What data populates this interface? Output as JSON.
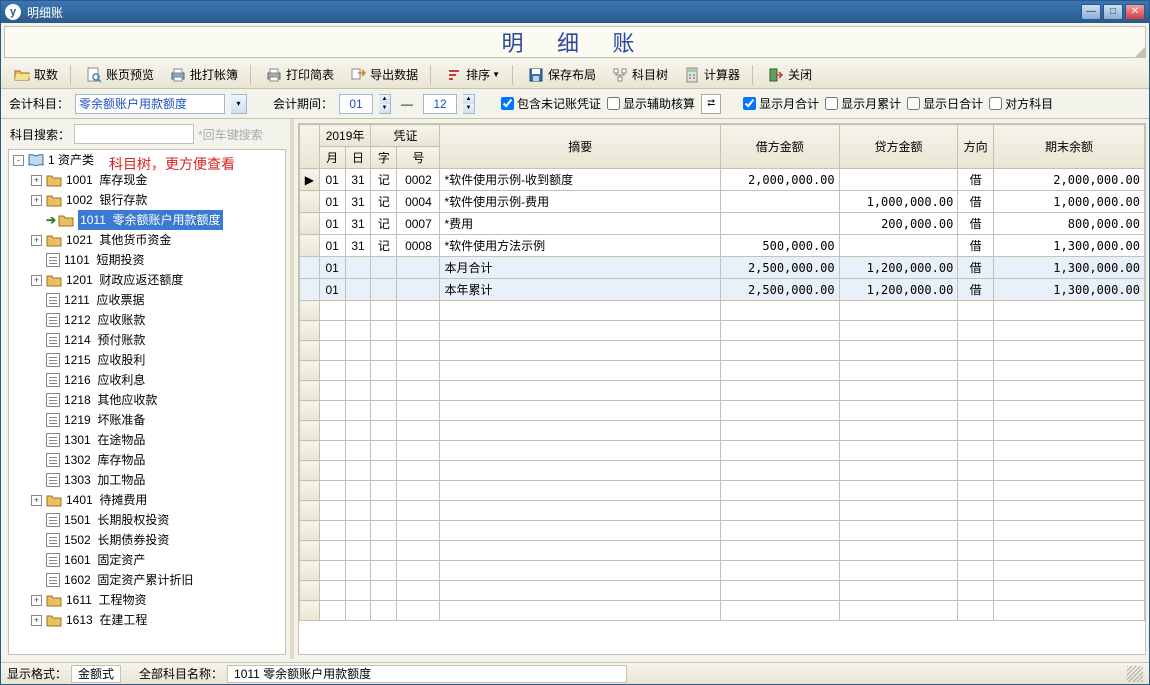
{
  "window": {
    "title": "明细账"
  },
  "header_title": "明 细 账",
  "toolbar": [
    {
      "id": "fetch",
      "label": "取数"
    },
    {
      "id": "preview",
      "label": "账页预览"
    },
    {
      "id": "batch",
      "label": "批打帐簿"
    },
    {
      "id": "print",
      "label": "打印简表"
    },
    {
      "id": "export",
      "label": "导出数据"
    },
    {
      "id": "sort",
      "label": "排序"
    },
    {
      "id": "savelay",
      "label": "保存布局"
    },
    {
      "id": "tree",
      "label": "科目树"
    },
    {
      "id": "calc",
      "label": "计算器"
    },
    {
      "id": "close",
      "label": "关闭"
    }
  ],
  "filter": {
    "subject_label": "会计科目：",
    "subject_value": "零余额账户用款额度",
    "period_label": "会计期间：",
    "period_from": "01",
    "period_to": "12",
    "dash": "—",
    "opts": {
      "include_unposted": {
        "label": "包含未记账凭证",
        "checked": true
      },
      "show_aux": {
        "label": "显示辅助核算",
        "checked": false
      },
      "show_month": {
        "label": "显示月合计",
        "checked": true
      },
      "show_month_cum": {
        "label": "显示月累计",
        "checked": false
      },
      "show_day": {
        "label": "显示日合计",
        "checked": false
      },
      "opp_subject": {
        "label": "对方科目",
        "checked": false
      }
    }
  },
  "search": {
    "label": "科目搜索：",
    "placeholder": "",
    "hint": "*回车键搜索"
  },
  "tree_annotation": "科目树，更方便查看",
  "tree": {
    "root": "1 资产类",
    "items": [
      {
        "code": "1001",
        "name": "库存现金",
        "exp": true,
        "folder": true
      },
      {
        "code": "1002",
        "name": "银行存款",
        "exp": true,
        "folder": true
      },
      {
        "code": "1011",
        "name": "零余额账户用款额度",
        "exp": false,
        "folder": true,
        "selected": true,
        "arrow": true
      },
      {
        "code": "1021",
        "name": "其他货币资金",
        "exp": true,
        "folder": true
      },
      {
        "code": "1101",
        "name": "短期投资",
        "exp": false,
        "folder": false
      },
      {
        "code": "1201",
        "name": "财政应返还额度",
        "exp": true,
        "folder": true
      },
      {
        "code": "1211",
        "name": "应收票据",
        "exp": false,
        "folder": false
      },
      {
        "code": "1212",
        "name": "应收账款",
        "exp": false,
        "folder": false
      },
      {
        "code": "1214",
        "name": "预付账款",
        "exp": false,
        "folder": false
      },
      {
        "code": "1215",
        "name": "应收股利",
        "exp": false,
        "folder": false
      },
      {
        "code": "1216",
        "name": "应收利息",
        "exp": false,
        "folder": false
      },
      {
        "code": "1218",
        "name": "其他应收款",
        "exp": false,
        "folder": false
      },
      {
        "code": "1219",
        "name": "坏账准备",
        "exp": false,
        "folder": false
      },
      {
        "code": "1301",
        "name": "在途物品",
        "exp": false,
        "folder": false
      },
      {
        "code": "1302",
        "name": "库存物品",
        "exp": false,
        "folder": false
      },
      {
        "code": "1303",
        "name": "加工物品",
        "exp": false,
        "folder": false
      },
      {
        "code": "1401",
        "name": "待摊费用",
        "exp": true,
        "folder": true
      },
      {
        "code": "1501",
        "name": "长期股权投资",
        "exp": false,
        "folder": false
      },
      {
        "code": "1502",
        "name": "长期债券投资",
        "exp": false,
        "folder": false
      },
      {
        "code": "1601",
        "name": "固定资产",
        "exp": false,
        "folder": false
      },
      {
        "code": "1602",
        "name": "固定资产累计折旧",
        "exp": false,
        "folder": false
      },
      {
        "code": "1611",
        "name": "工程物资",
        "exp": true,
        "folder": true
      },
      {
        "code": "1613",
        "name": "在建工程",
        "exp": true,
        "folder": true
      }
    ]
  },
  "grid": {
    "year": "2019年",
    "headers": {
      "voucher": "凭证",
      "month": "月",
      "day": "日",
      "type": "字",
      "no": "号",
      "summary": "摘要",
      "debit": "借方金额",
      "credit": "贷方金额",
      "dir": "方向",
      "balance": "期末余额"
    },
    "rows": [
      {
        "m": "01",
        "d": "31",
        "t": "记",
        "n": "0002",
        "sum": "*软件使用示例-收到额度",
        "dr": "2,000,000.00",
        "cr": "",
        "dir": "借",
        "bal": "2,000,000.00",
        "ptr": true
      },
      {
        "m": "01",
        "d": "31",
        "t": "记",
        "n": "0004",
        "sum": "*软件使用示例-费用",
        "dr": "",
        "cr": "1,000,000.00",
        "dir": "借",
        "bal": "1,000,000.00"
      },
      {
        "m": "01",
        "d": "31",
        "t": "记",
        "n": "0007",
        "sum": "*费用",
        "dr": "",
        "cr": "200,000.00",
        "dir": "借",
        "bal": "800,000.00"
      },
      {
        "m": "01",
        "d": "31",
        "t": "记",
        "n": "0008",
        "sum": "*软件使用方法示例",
        "dr": "500,000.00",
        "cr": "",
        "dir": "借",
        "bal": "1,300,000.00"
      },
      {
        "m": "01",
        "d": "",
        "t": "",
        "n": "",
        "sum": "本月合计",
        "dr": "2,500,000.00",
        "cr": "1,200,000.00",
        "dir": "借",
        "bal": "1,300,000.00",
        "total": true
      },
      {
        "m": "01",
        "d": "",
        "t": "",
        "n": "",
        "sum": "本年累计",
        "dr": "2,500,000.00",
        "cr": "1,200,000.00",
        "dir": "借",
        "bal": "1,300,000.00",
        "total": true
      }
    ]
  },
  "status": {
    "fmt_label": "显示格式：",
    "fmt_value": "金额式",
    "name_label": "全部科目名称：",
    "name_value": "1011   零余额账户用款额度"
  }
}
